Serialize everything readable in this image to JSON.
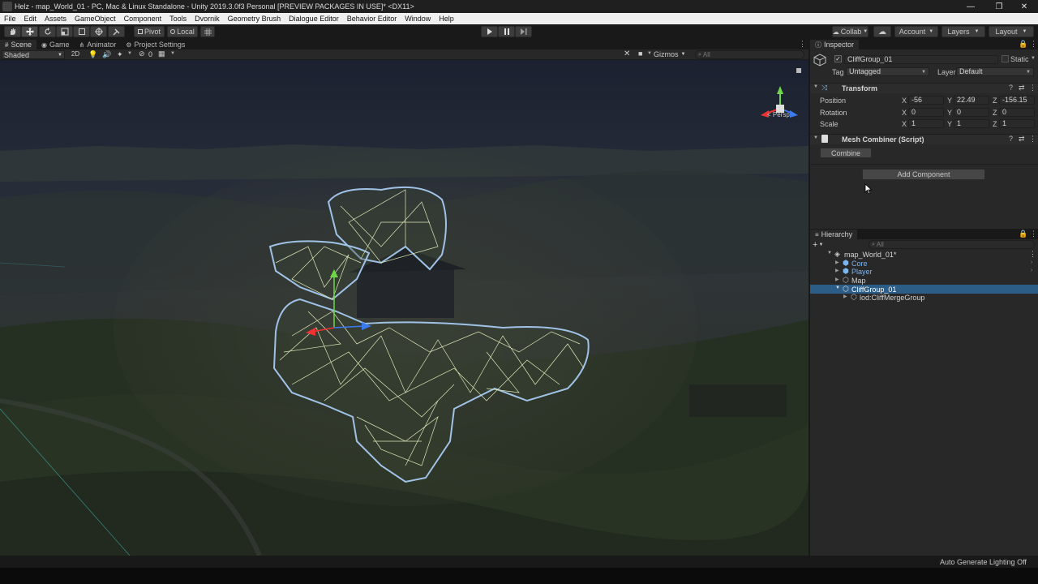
{
  "window": {
    "title": "Helz - map_World_01 - PC, Mac & Linux Standalone - Unity 2019.3.0f3 Personal [PREVIEW PACKAGES IN USE]* <DX11>",
    "controls": [
      "—",
      "❐",
      "✕"
    ]
  },
  "menu": [
    "File",
    "Edit",
    "Assets",
    "GameObject",
    "Component",
    "Tools",
    "Dvornik",
    "Geometry Brush",
    "Dialogue Editor",
    "Behavior Editor",
    "Window",
    "Help"
  ],
  "toolbar": {
    "pivot": "Pivot",
    "local": "Local",
    "collab": "Collab",
    "account": "Account",
    "layers": "Layers",
    "layout": "Layout"
  },
  "scene_tabs": [
    "Scene",
    "Game",
    "Animator",
    "Project Settings"
  ],
  "scene_toolbar": {
    "shading": "Shaded",
    "mode_2d": "2D",
    "fx_count": "0",
    "gizmos": "Gizmos",
    "search_placeholder": "All",
    "persp": "< Persp"
  },
  "inspector": {
    "tab": "Inspector",
    "object_name": "CliffGroup_01",
    "static_label": "Static",
    "tag_label": "Tag",
    "tag_value": "Untagged",
    "layer_label": "Layer",
    "layer_value": "Default",
    "transform": {
      "title": "Transform",
      "position_label": "Position",
      "rotation_label": "Rotation",
      "scale_label": "Scale",
      "position": {
        "x": "-56",
        "y": "22.49",
        "z": "-156.15"
      },
      "rotation": {
        "x": "0",
        "y": "0",
        "z": "0"
      },
      "scale": {
        "x": "1",
        "y": "1",
        "z": "1"
      },
      "axis_x": "X",
      "axis_y": "Y",
      "axis_z": "Z"
    },
    "mesh_combiner": {
      "title": "Mesh Combiner (Script)",
      "combine_button": "Combine"
    },
    "add_component": "Add Component"
  },
  "hierarchy": {
    "tab": "Hierarchy",
    "search_placeholder": "All",
    "scene": "map_World_01*",
    "items": [
      {
        "label": "Core"
      },
      {
        "label": "Player"
      },
      {
        "label": "Map"
      },
      {
        "label": "CliffGroup_01"
      },
      {
        "label": "lod:CliffMergeGroup"
      }
    ]
  },
  "status": {
    "lighting": "Auto Generate Lighting Off"
  },
  "colors": {
    "accent_selection": "#2c5d87",
    "prefab_blue": "#7ab6f2",
    "wireframe": "#dfe8b8",
    "selection_outline": "#9fc2e6"
  }
}
